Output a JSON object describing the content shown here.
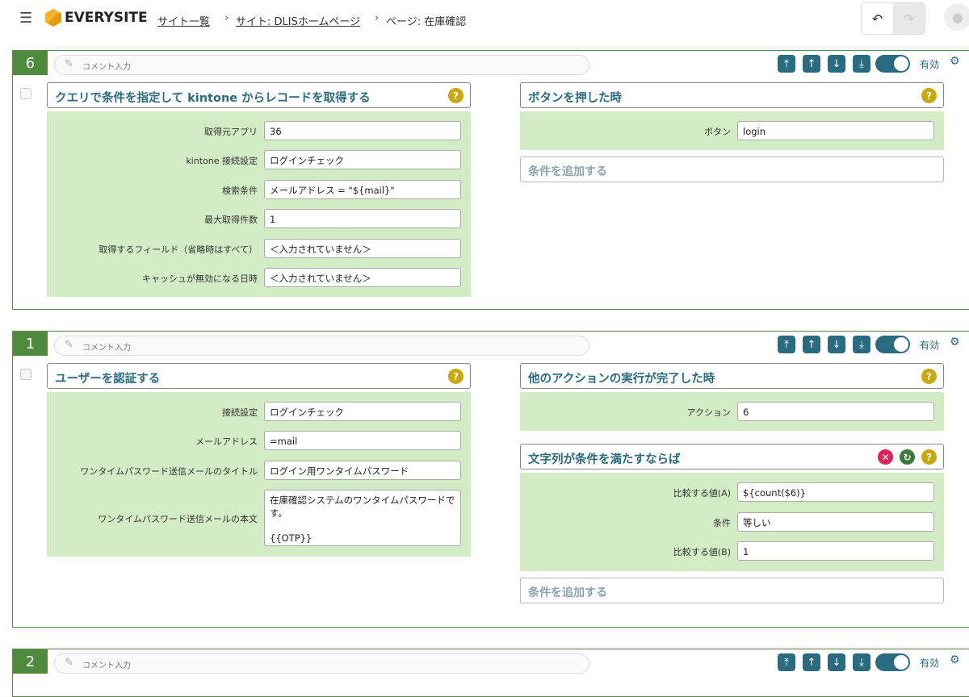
{
  "header": {
    "brand": "EVERYSITE",
    "breadcrumbs": [
      "サイト一覧",
      "サイト: DLISホームページ",
      "ページ: 在庫確認"
    ],
    "undo_icon": "undo-icon",
    "redo_icon": "redo-icon"
  },
  "common": {
    "comment_placeholder": "コメント入力",
    "enabled_label": "有効",
    "add_condition": "条件を追加する"
  },
  "blocks": [
    {
      "number": "6",
      "action": {
        "title": "クエリで条件を指定して kintone からレコードを取得する",
        "fields": [
          {
            "label": "取得元アプリ",
            "value": "36"
          },
          {
            "label": "kintone 接続設定",
            "value": "ログインチェック"
          },
          {
            "label": "検索条件",
            "value": "メールアドレス = \"${mail}\""
          },
          {
            "label": "最大取得件数",
            "value": "1"
          },
          {
            "label": "取得するフィールド（省略時はすべて）",
            "value": "＜入力されていません＞"
          },
          {
            "label": "キャッシュが無効になる日時",
            "value": "＜入力されていません＞"
          }
        ]
      },
      "triggers": [
        {
          "title": "ボタンを押した時",
          "fields": [
            {
              "label": "ボタン",
              "value": "login"
            }
          ]
        }
      ]
    },
    {
      "number": "1",
      "action": {
        "title": "ユーザーを認証する",
        "fields": [
          {
            "label": "接続設定",
            "value": "ログインチェック"
          },
          {
            "label": "メールアドレス",
            "value": "=mail"
          },
          {
            "label": "ワンタイムパスワード送信メールのタイトル",
            "value": "ログイン用ワンタイムパスワード"
          },
          {
            "label": "ワンタイムパスワード送信メールの本文",
            "value": "在庫確認システムのワンタイムパスワードです。\n\n{{OTP}}"
          }
        ]
      },
      "triggers": [
        {
          "title": "他のアクションの実行が完了した時",
          "fields": [
            {
              "label": "アクション",
              "value": "6"
            }
          ]
        },
        {
          "title": "文字列が条件を満たすならば",
          "fields": [
            {
              "label": "比較する値(A)",
              "value": "${count($6)}"
            },
            {
              "label": "条件",
              "value": "等しい"
            },
            {
              "label": "比較する値(B)",
              "value": "1"
            }
          ]
        }
      ]
    },
    {
      "number": "2"
    }
  ]
}
